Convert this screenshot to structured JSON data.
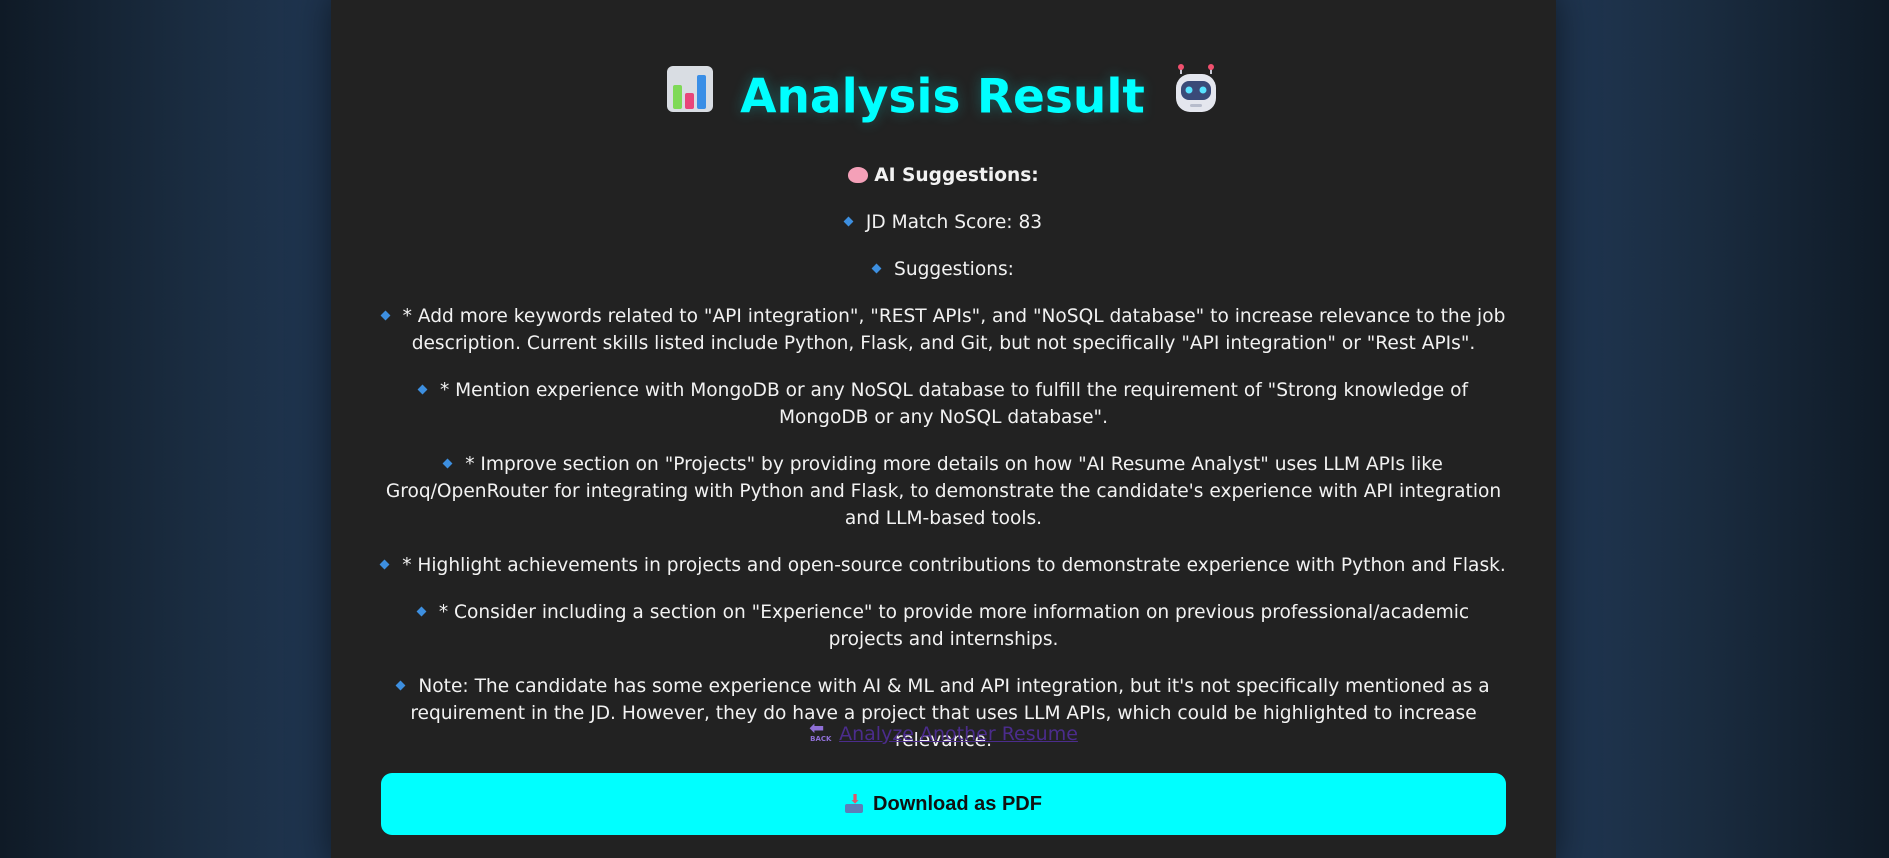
{
  "header": {
    "icon_left": "bar-chart-emoji",
    "title": "Analysis Result",
    "icon_right": "robot-emoji"
  },
  "suggestions": {
    "heading": "AI Suggestions:",
    "heading_icon": "brain-emoji",
    "bullet_color": "#3d8fe0",
    "items": [
      "JD Match Score: 83",
      "Suggestions:",
      "* Add more keywords related to \"API integration\", \"REST APIs\", and \"NoSQL database\" to increase relevance to the job description. Current skills listed include Python, Flask, and Git, but not specifically \"API integration\" or \"Rest APIs\".",
      "* Mention experience with MongoDB or any NoSQL database to fulfill the requirement of \"Strong knowledge of MongoDB or any NoSQL database\".",
      "* Improve section on \"Projects\" by providing more details on how \"AI Resume Analyst\" uses LLM APIs like Groq/OpenRouter for integrating with Python and Flask, to demonstrate the candidate's experience with API integration and LLM-based tools.",
      "* Highlight achievements in projects and open-source contributions to demonstrate experience with Python and Flask.",
      "* Consider including a section on \"Experience\" to provide more information on previous professional/academic projects and internships.",
      "Note: The candidate has some experience with AI & ML and API integration, but it's not specifically mentioned as a requirement in the JD. However, they do have a project that uses LLM APIs, which could be highlighted to increase relevance."
    ]
  },
  "actions": {
    "back_icon": "back-arrow-emoji",
    "back_icon_text": "BACK",
    "back_label": "Analyze Another Resume",
    "download_icon": "inbox-tray-emoji",
    "download_label": "Download as PDF"
  },
  "colors": {
    "accent": "#00ffff",
    "panel": "#222222",
    "link": "#4b2c8c"
  }
}
